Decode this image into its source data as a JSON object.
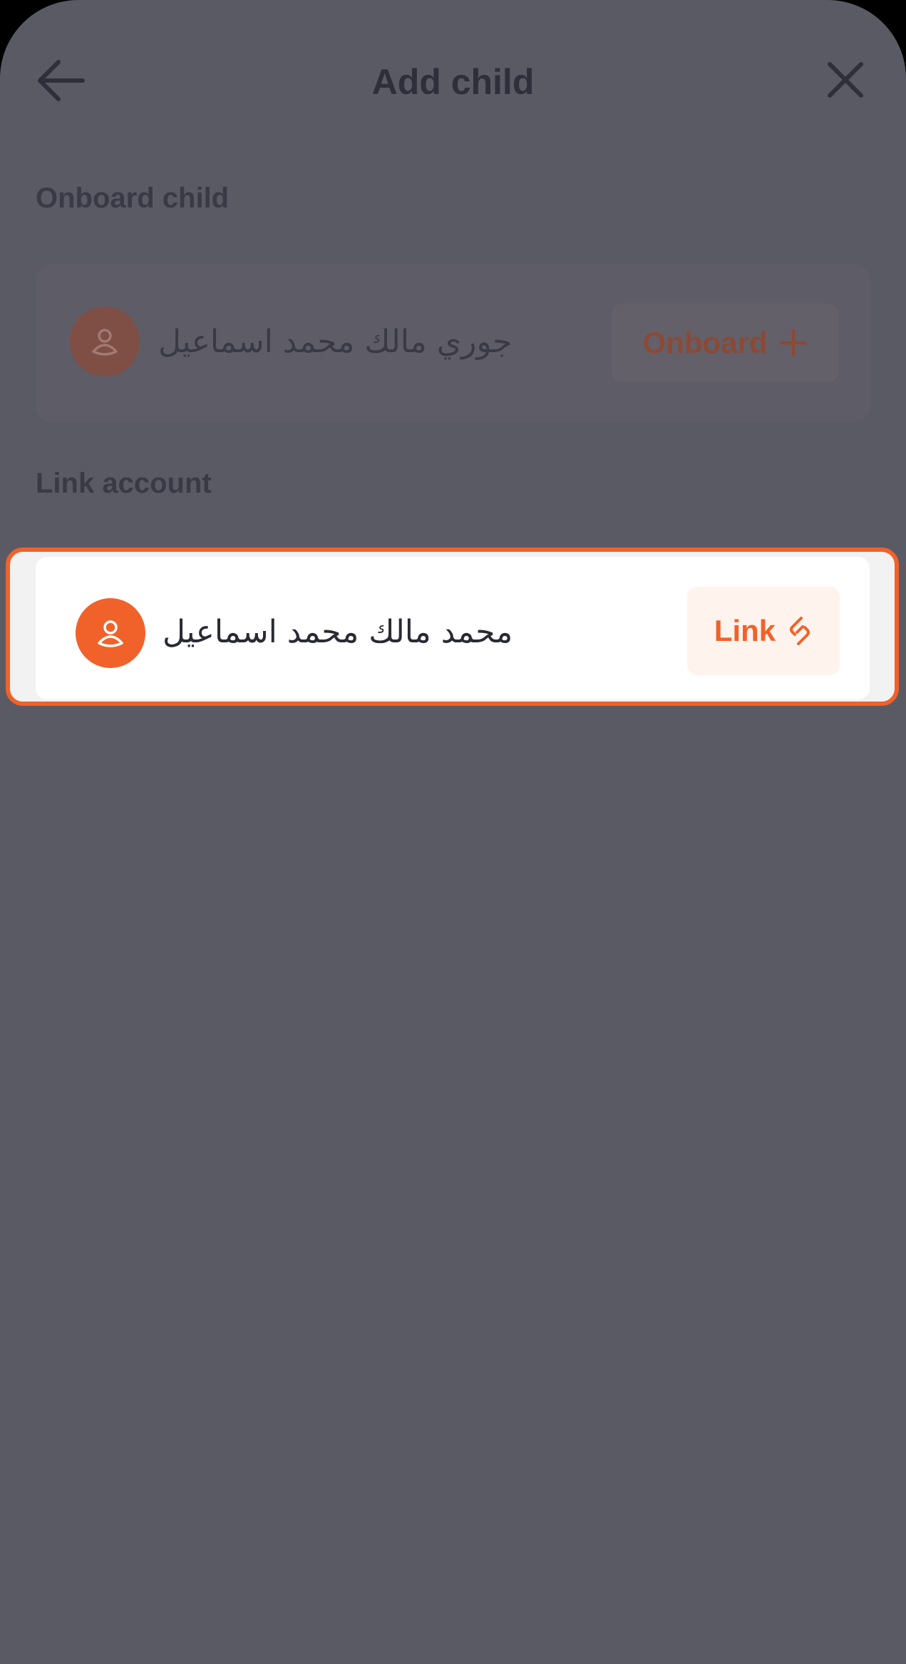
{
  "header": {
    "title": "Add child",
    "back_icon": "arrow-left-icon",
    "close_icon": "close-icon"
  },
  "onboard_section": {
    "label": "Onboard child",
    "child": {
      "name": "جوري مالك محمد اسماعيل",
      "avatar_icon": "user-icon",
      "button_label": "Onboard",
      "button_icon": "plus-icon"
    }
  },
  "link_section": {
    "label": "Link account",
    "child": {
      "name": "محمد مالك محمد اسماعيل",
      "avatar_icon": "user-icon",
      "button_label": "Link",
      "button_icon": "link-icon"
    }
  },
  "colors": {
    "accent": "#f0622a",
    "overlay": "#5a5a64",
    "text_dark": "#2f2f3b"
  }
}
